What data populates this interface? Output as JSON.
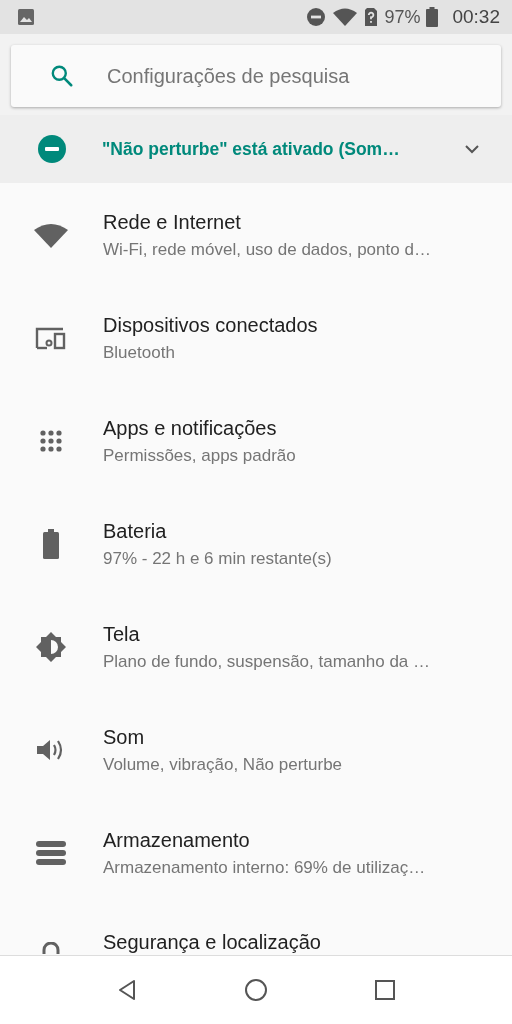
{
  "status_bar": {
    "battery": "97%",
    "time": "00:32"
  },
  "search": {
    "placeholder": "Configurações de pesquisa"
  },
  "suggestion": {
    "text": "\"Não perturbe\" está ativado (Som…",
    "expanded": false
  },
  "items": [
    {
      "kind": "wifi",
      "title": "Rede e Internet",
      "subtitle": "Wi-Fi, rede móvel, uso de dados, ponto d…"
    },
    {
      "kind": "devices",
      "title": "Dispositivos conectados",
      "subtitle": "Bluetooth"
    },
    {
      "kind": "apps",
      "title": "Apps e notificações",
      "subtitle": "Permissões, apps padrão"
    },
    {
      "kind": "battery",
      "title": "Bateria",
      "subtitle": "97% - 22 h e 6 min restante(s)"
    },
    {
      "kind": "display",
      "title": "Tela",
      "subtitle": "Plano de fundo, suspensão, tamanho da …"
    },
    {
      "kind": "sound",
      "title": "Som",
      "subtitle": "Volume, vibração, Não perturbe"
    },
    {
      "kind": "storage",
      "title": "Armazenamento",
      "subtitle": "Armazenamento interno: 69% de utilizaç…"
    },
    {
      "kind": "lock",
      "title": "Segurança e localização"
    }
  ]
}
